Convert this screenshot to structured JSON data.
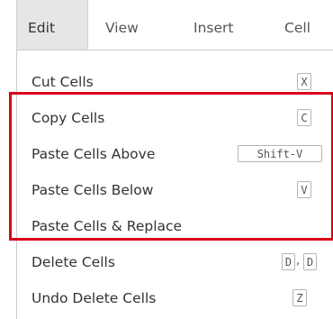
{
  "menubar": {
    "tabs": [
      {
        "label": "Edit",
        "active": true
      },
      {
        "label": "View",
        "active": false
      },
      {
        "label": "Insert",
        "active": false
      },
      {
        "label": "Cell",
        "active": false
      }
    ]
  },
  "edit_menu": {
    "items": [
      {
        "label": "Cut Cells",
        "shortcut": [
          "X"
        ]
      },
      {
        "label": "Copy Cells",
        "shortcut": [
          "C"
        ]
      },
      {
        "label": "Paste Cells Above",
        "shortcut": [
          "Shift-V"
        ]
      },
      {
        "label": "Paste Cells Below",
        "shortcut": [
          "V"
        ]
      },
      {
        "label": "Paste Cells & Replace",
        "shortcut": []
      },
      {
        "label": "Delete Cells",
        "shortcut": [
          "D",
          "D"
        ],
        "shortcut_separator": ","
      },
      {
        "label": "Undo Delete Cells",
        "shortcut": [
          "Z"
        ]
      }
    ]
  },
  "colors": {
    "highlight_border": "#d9001b",
    "active_tab_bg": "#e6e6e6"
  }
}
